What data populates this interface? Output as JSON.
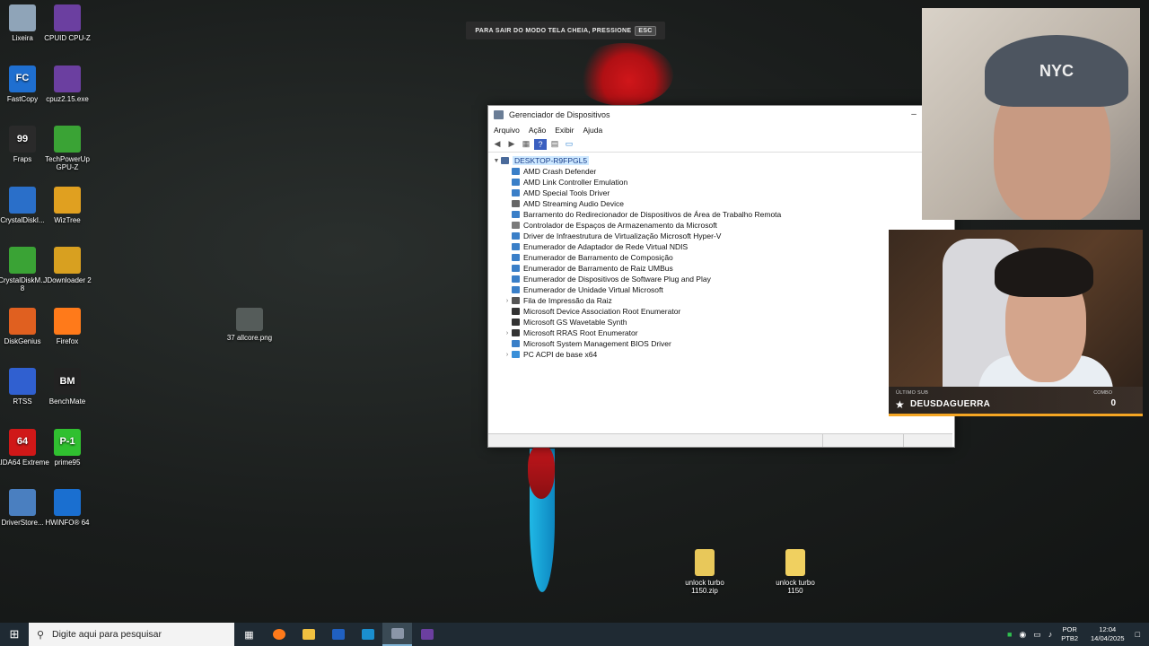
{
  "fullscreen_notice": {
    "text": "PARA SAIR DO MODO TELA CHEIA, PRESSIONE",
    "key": "ESC"
  },
  "desktop_icons": [
    {
      "label": "Lixeira",
      "icon": "recycle-bin-icon",
      "color": "#8fa4b8"
    },
    {
      "label": "CPUID CPU-Z",
      "icon": "cpu-z-icon",
      "color": "#6b3fa0"
    },
    {
      "label": "FastCopy",
      "icon": "fastcopy-icon",
      "color": "#1f6fd0",
      "glyph": "FC"
    },
    {
      "label": "cpuz2.15.exe",
      "icon": "cpu-z-exe-icon",
      "color": "#6b3fa0"
    },
    {
      "label": "Fraps",
      "icon": "fraps-icon",
      "color": "#2a2a2a",
      "glyph": "99"
    },
    {
      "label": "TechPowerUp GPU-Z",
      "icon": "gpu-z-icon",
      "color": "#3aa335"
    },
    {
      "label": "CrystalDiskI...",
      "icon": "crystaldiskinfo-icon",
      "color": "#2a6fc9"
    },
    {
      "label": "WizTree",
      "icon": "wiztree-icon",
      "color": "#e0a020"
    },
    {
      "label": "CrystalDiskM... 8",
      "icon": "crystaldiskmark-icon",
      "color": "#3aa335"
    },
    {
      "label": "JDownloader 2",
      "icon": "jdownloader-icon",
      "color": "#d8a020"
    },
    {
      "label": "DiskGenius",
      "icon": "diskgenius-icon",
      "color": "#e06020"
    },
    {
      "label": "Firefox",
      "icon": "firefox-icon",
      "color": "#ff7a1a"
    },
    {
      "label": "RTSS",
      "icon": "rtss-icon",
      "color": "#3060d0"
    },
    {
      "label": "BenchMate",
      "icon": "benchmate-icon",
      "color": "#222222",
      "glyph": "BM"
    },
    {
      "label": "AIDA64 Extreme",
      "icon": "aida64-icon",
      "color": "#d01818",
      "glyph": "64"
    },
    {
      "label": "prime95",
      "icon": "prime95-icon",
      "color": "#30c030",
      "glyph": "P-1"
    },
    {
      "label": "DriverStore...",
      "icon": "driverstore-icon",
      "color": "#4a7fc0"
    },
    {
      "label": "HWiNFO® 64",
      "icon": "hwinfo-icon",
      "color": "#1a6fd0"
    }
  ],
  "desktop_file": {
    "label": "37 allcore.png",
    "icon": "image-file-icon"
  },
  "desktop_zip": {
    "label": "unlock turbo 1150.zip",
    "icon": "zip-folder-icon"
  },
  "desktop_folder": {
    "label": "unlock turbo 1150",
    "icon": "folder-icon"
  },
  "window": {
    "title": "Gerenciador de Dispositivos",
    "menu": [
      "Arquivo",
      "Ação",
      "Exibir",
      "Ajuda"
    ],
    "root": "DESKTOP-R9FPGL5",
    "items": [
      {
        "label": "AMD Crash Defender",
        "expandable": false,
        "icon": "system-device-icon"
      },
      {
        "label": "AMD Link Controller Emulation",
        "expandable": false,
        "icon": "system-device-icon"
      },
      {
        "label": "AMD Special Tools Driver",
        "expandable": false,
        "icon": "system-device-icon"
      },
      {
        "label": "AMD Streaming Audio Device",
        "expandable": false,
        "icon": "audio-device-icon"
      },
      {
        "label": "Barramento do Redirecionador de Dispositivos de Área de Trabalho Remota",
        "expandable": false,
        "icon": "system-device-icon"
      },
      {
        "label": "Controlador de Espaços de Armazenamento da Microsoft",
        "expandable": false,
        "icon": "storage-icon"
      },
      {
        "label": "Driver de Infraestrutura de Virtualização Microsoft Hyper-V",
        "expandable": false,
        "icon": "system-device-icon"
      },
      {
        "label": "Enumerador de Adaptador de Rede Virtual NDIS",
        "expandable": false,
        "icon": "system-device-icon"
      },
      {
        "label": "Enumerador de Barramento de Composição",
        "expandable": false,
        "icon": "system-device-icon"
      },
      {
        "label": "Enumerador de Barramento de Raiz UMBus",
        "expandable": false,
        "icon": "system-device-icon"
      },
      {
        "label": "Enumerador de Dispositivos de Software Plug and Play",
        "expandable": false,
        "icon": "system-device-icon"
      },
      {
        "label": "Enumerador de Unidade Virtual Microsoft",
        "expandable": false,
        "icon": "system-device-icon"
      },
      {
        "label": "Fila de Impressão da Raiz",
        "expandable": true,
        "icon": "printer-icon"
      },
      {
        "label": "Microsoft Device Association Root Enumerator",
        "expandable": false,
        "icon": "generic-device-icon"
      },
      {
        "label": "Microsoft GS Wavetable Synth",
        "expandable": false,
        "icon": "generic-device-icon"
      },
      {
        "label": "Microsoft RRAS Root Enumerator",
        "expandable": true,
        "icon": "generic-device-icon"
      },
      {
        "label": "Microsoft System Management BIOS Driver",
        "expandable": false,
        "icon": "system-device-icon"
      },
      {
        "label": "PC ACPI de base x64",
        "expandable": true,
        "icon": "computer-icon"
      }
    ]
  },
  "stream_overlay": {
    "left_label": "ÚLTIMO SUB",
    "subscriber": "DEUSDAGUERRA",
    "right_label": "COMBO",
    "count": "0",
    "cap_text": "NYC"
  },
  "taskbar": {
    "search_placeholder": "Digite aqui para pesquisar",
    "lang_top": "POR",
    "lang_bottom": "PTB2",
    "time": "12:04",
    "date": "14/04/2025"
  },
  "colors": {
    "accent": "#0078d7",
    "taskbar": "#1f2a33",
    "banner_bar": "#f5a623"
  }
}
